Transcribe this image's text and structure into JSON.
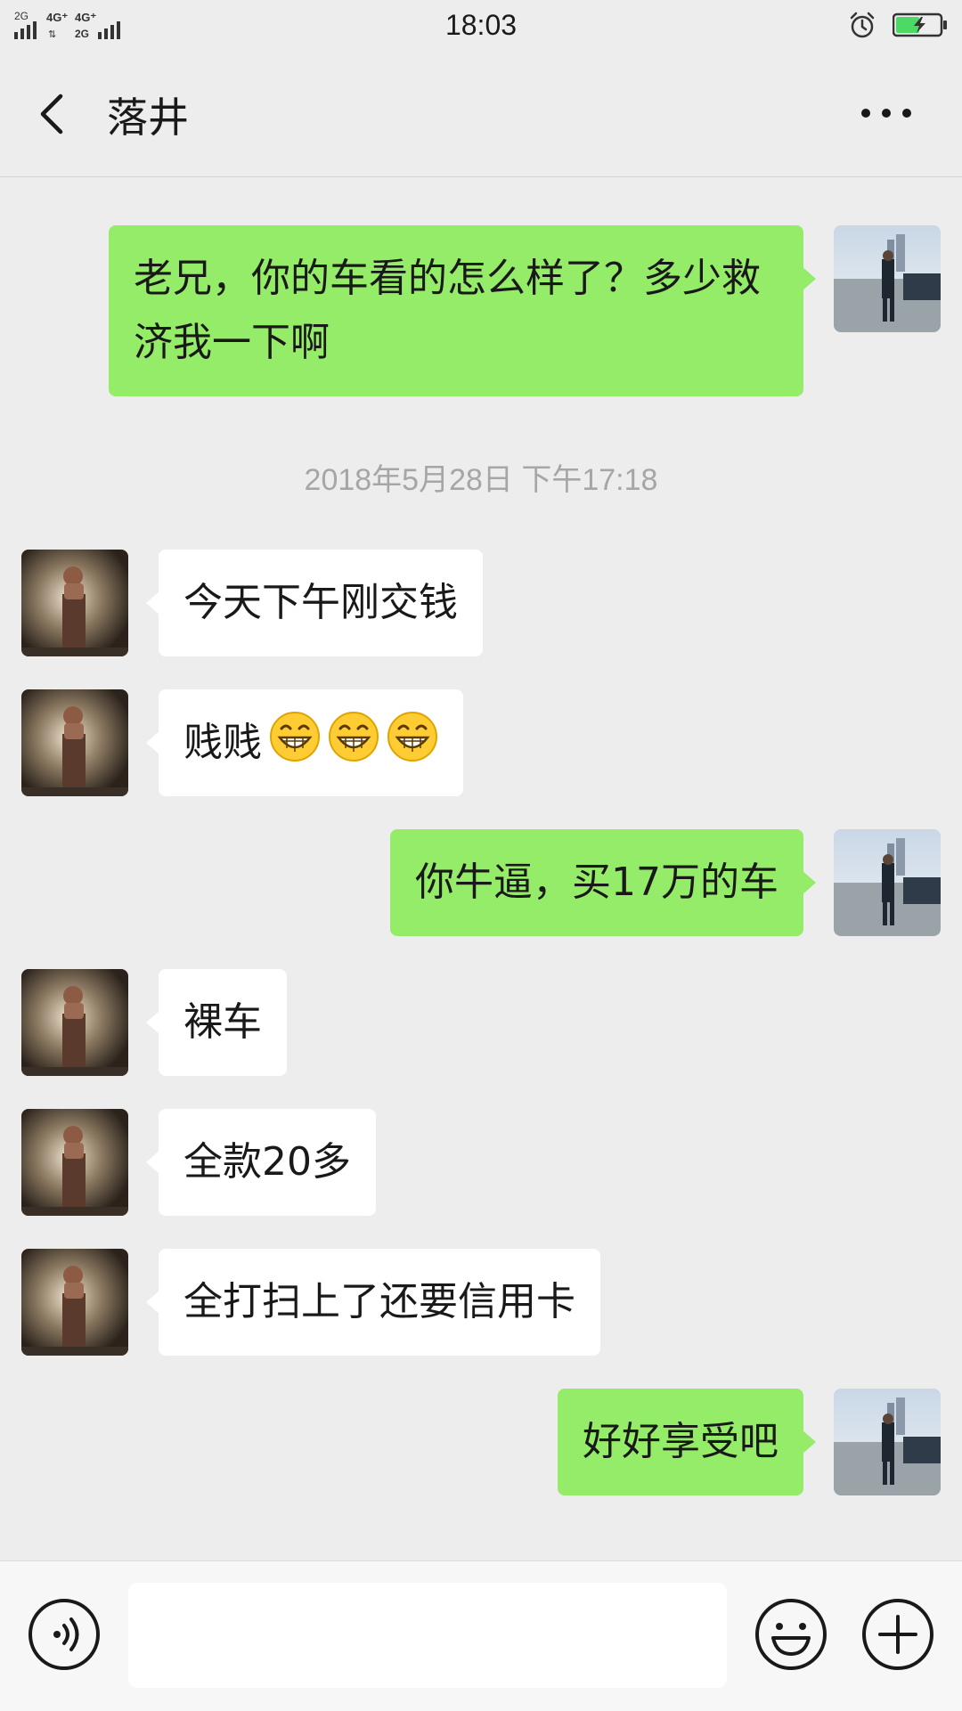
{
  "status_bar": {
    "network_left": "2G",
    "network_mid": "4G⁺ 4G⁺ 2G",
    "time": "18:03",
    "alarm_icon": "alarm-clock-icon",
    "battery_icon": "battery-charging-icon",
    "battery_color": "#4cd964"
  },
  "header": {
    "back_icon": "chevron-left-icon",
    "title": "落井",
    "more_icon": "more-horizontal-icon"
  },
  "messages": [
    {
      "side": "out",
      "text": "老兄，你的车看的怎么样了？多少救济我一下啊"
    },
    {
      "side": "timestamp",
      "text": "2018年5月28日 下午17:18"
    },
    {
      "side": "in",
      "text": "今天下午刚交钱"
    },
    {
      "side": "in",
      "text": "贱贱",
      "emoji": [
        "grinning-face-icon",
        "grinning-face-icon",
        "grinning-face-icon"
      ]
    },
    {
      "side": "out",
      "text": "你牛逼，买17万的车"
    },
    {
      "side": "in",
      "text": "裸车"
    },
    {
      "side": "in",
      "text": "全款20多"
    },
    {
      "side": "in",
      "text": "全打扫上了还要信用卡"
    },
    {
      "side": "out",
      "text": "好好享受吧"
    }
  ],
  "input_bar": {
    "voice_icon": "voice-icon",
    "input_value": "",
    "emoji_icon": "smiley-icon",
    "plus_icon": "plus-circle-icon"
  },
  "colors": {
    "background": "#ededed",
    "outgoing_bubble": "#95ec69",
    "incoming_bubble": "#ffffff",
    "timestamp_text": "#a6a6a6"
  }
}
